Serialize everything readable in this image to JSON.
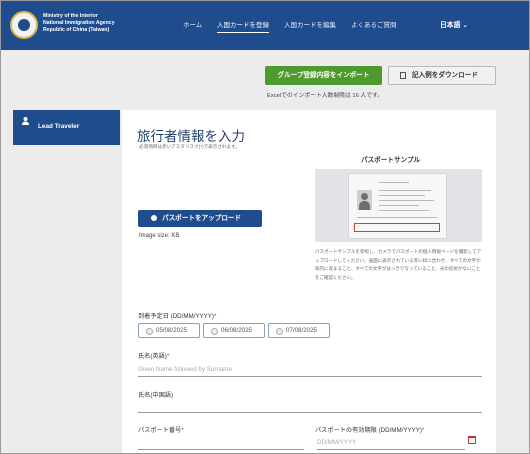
{
  "header": {
    "agency_lines": [
      "Ministry of the Interior",
      "National Immigration Agency",
      "Republic of China (Taiwan)"
    ],
    "nav": [
      "ホーム",
      "入国カードを登録",
      "入国カードを編集",
      "よくあるご質問"
    ],
    "language": "日本語 ⌄"
  },
  "toolbar": {
    "import_label": "グループ登録内容をインポート",
    "download_label": "記入例をダウンロード",
    "import_limit": "Excelでのインポート人数制限は 16 人です。"
  },
  "sidebar": {
    "items": [
      {
        "label": "Lead Traveler"
      }
    ]
  },
  "form": {
    "title": "旅行者情報を入力",
    "required_note": "必須項目は赤いアスタリスク(*)で表示されます。",
    "upload_label": "パスポートをアップロード",
    "image_size": "Image size: KB",
    "passport_sample": {
      "heading": "パスポートサンプル",
      "description": "パスポートサンプルを参照し、カメラでパスポートの個人情報ページを撮影してアップロードしてください。画面に表示されている赤い枠に合わせ、すべての文字が枠内に収まること、すべての文字がはっきり写っていること、光の反射がないことをご確認ください。"
    },
    "arrival_date": {
      "label": "到着予定日 (DD/MM/YYYY)",
      "required": "*",
      "options": [
        "05/08/2025",
        "06/08/2025",
        "07/08/2025"
      ]
    },
    "name_en": {
      "label": "氏名(英語)",
      "required": "*",
      "placeholder": "Given Name followed by Surname"
    },
    "name_zh": {
      "label": "氏名(中国語)"
    },
    "passport_no": {
      "label": "パスポート番号",
      "required": "*"
    },
    "passport_expiry": {
      "label": "パスポートの有効期限 (DD/MM/YYYY)",
      "required": "*",
      "placeholder": "DD/MM/YYYY"
    }
  },
  "colors": {
    "primary": "#1f4c8c",
    "import_button": "#4f9a2f",
    "required": "#d32f2f"
  },
  "icons": [
    "emblem-logo",
    "download-icon",
    "user-icon",
    "camera-icon",
    "calendar-icon",
    "chevron-down-icon"
  ]
}
